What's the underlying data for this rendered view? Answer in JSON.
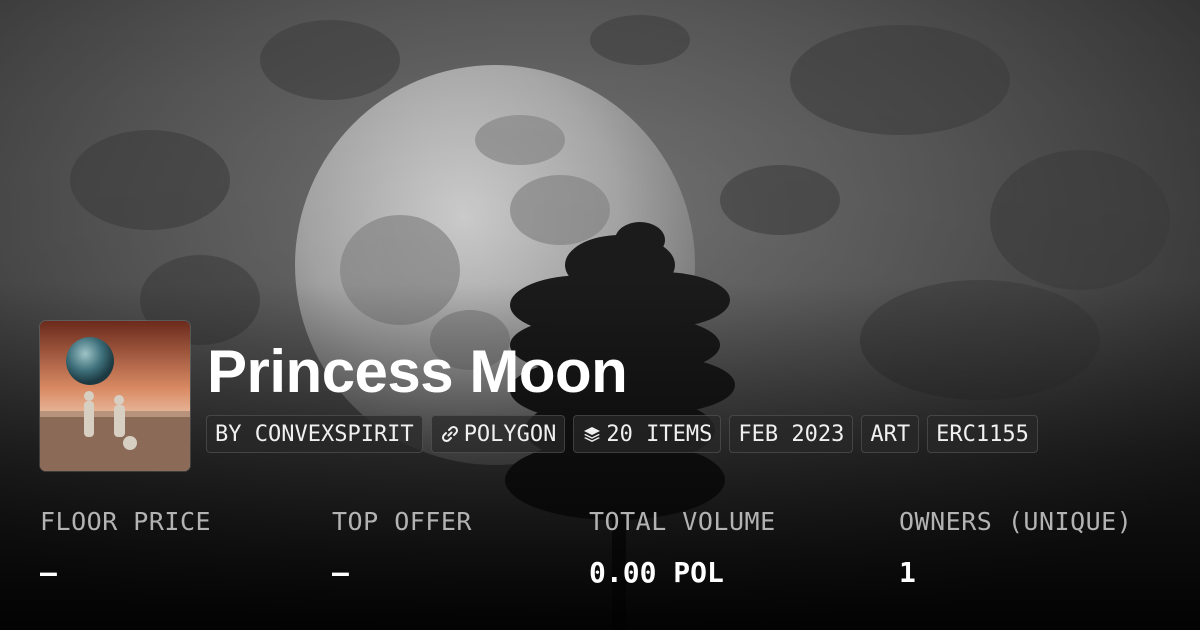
{
  "collection": {
    "name": "Princess Moon",
    "tags": [
      {
        "label": "BY CONVEXSPIRIT",
        "icon": ""
      },
      {
        "label": "POLYGON",
        "icon": "link-icon"
      },
      {
        "label": "20 ITEMS",
        "icon": "layers-icon"
      },
      {
        "label": "FEB 2023",
        "icon": ""
      },
      {
        "label": "ART",
        "icon": ""
      },
      {
        "label": "ERC1155",
        "icon": ""
      }
    ]
  },
  "stats": [
    {
      "label": "FLOOR PRICE",
      "value": "–"
    },
    {
      "label": "TOP OFFER",
      "value": "–"
    },
    {
      "label": "TOTAL VOLUME",
      "value": "0.00 POL"
    },
    {
      "label": "OWNERS (UNIQUE)",
      "value": "1"
    }
  ],
  "colors": {
    "background": "#1b1b1b",
    "label": "#b3b3b3",
    "value": "#ffffff",
    "tag_background": "#282828"
  }
}
